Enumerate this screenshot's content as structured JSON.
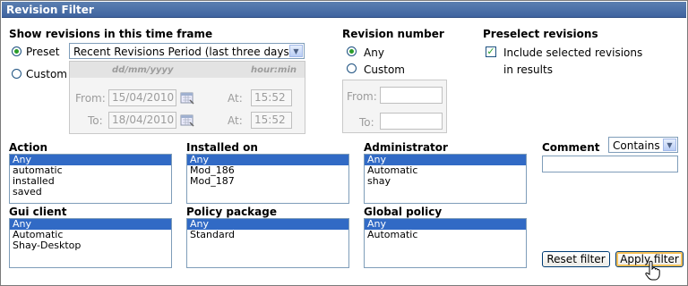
{
  "window": {
    "title": "Revision Filter"
  },
  "timeframe": {
    "heading": "Show revisions in this time frame",
    "preset_label": "Preset",
    "preset_value": "Recent Revisions Period (last three days)",
    "custom_label": "Custom",
    "date_header": "dd/mm/yyyy",
    "time_header": "hour:min",
    "from_label": "From:",
    "to_label": "To:",
    "from_date": "15/04/2010",
    "to_date": "18/04/2010",
    "at_label": "At:",
    "from_time": "15:52",
    "to_time": "15:52"
  },
  "revision_number": {
    "heading": "Revision number",
    "any_label": "Any",
    "custom_label": "Custom",
    "from_label": "From:",
    "to_label": "To:",
    "from_value": "",
    "to_value": ""
  },
  "preselect": {
    "heading": "Preselect revisions",
    "checkbox_line1": "Include selected revisions",
    "checkbox_line2": "in  results",
    "checked": true
  },
  "lists": {
    "action": {
      "label": "Action",
      "items": [
        "Any",
        "automatic",
        "installed",
        "saved"
      ]
    },
    "installed_on": {
      "label": "Installed on",
      "items": [
        "Any",
        "Mod_186",
        "Mod_187"
      ]
    },
    "administrator": {
      "label": "Administrator",
      "items": [
        "Any",
        "Automatic",
        "shay"
      ]
    },
    "gui_client": {
      "label": "Gui client",
      "items": [
        "Any",
        "Automatic",
        "Shay-Desktop"
      ]
    },
    "policy_package": {
      "label": "Policy package",
      "items": [
        "Any",
        "Standard"
      ]
    },
    "global_policy": {
      "label": "Global policy",
      "items": [
        "Any",
        "Automatic"
      ]
    }
  },
  "comment": {
    "label": "Comment",
    "operator": "Contains",
    "value": ""
  },
  "buttons": {
    "reset": "Reset filter",
    "apply": "Apply filter"
  },
  "colors": {
    "title_bar": "#4a6fa8",
    "selection": "#316ac5",
    "radio_dot": "#2a9d2a"
  }
}
